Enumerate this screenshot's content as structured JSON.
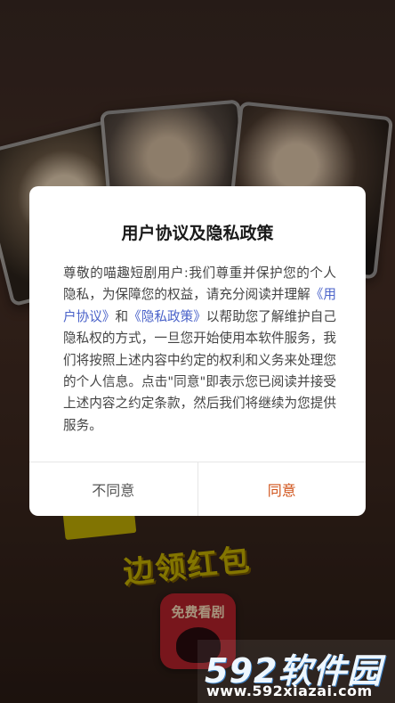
{
  "background": {
    "promo_text": "边领红包",
    "app_logo_text": "免费看剧"
  },
  "dialog": {
    "title": "用户协议及隐私政策",
    "body_part1": "尊敬的喵趣短剧用户:我们尊重并保护您的个人隐私，为保障您的权益，请充分阅读并理解",
    "link_user_agreement": "《用户协议》",
    "body_and": "和",
    "link_privacy_policy": "《隐私政策》",
    "body_part2": "以帮助您了解维护自己隐私权的方式，一旦您开始使用本软件服务，我们将按照上述内容中约定的权利和义务来处理您的个人信息。点击\"同意\"即表示您已阅读并接受上述内容之约定条款，然后我们将继续为您提供服务。",
    "disagree_label": "不同意",
    "agree_label": "同意"
  },
  "watermark": {
    "brand": "592软件园",
    "url": "www.592xiazai.com"
  },
  "colors": {
    "agree": "#d0531a",
    "link": "#4a62c9"
  }
}
